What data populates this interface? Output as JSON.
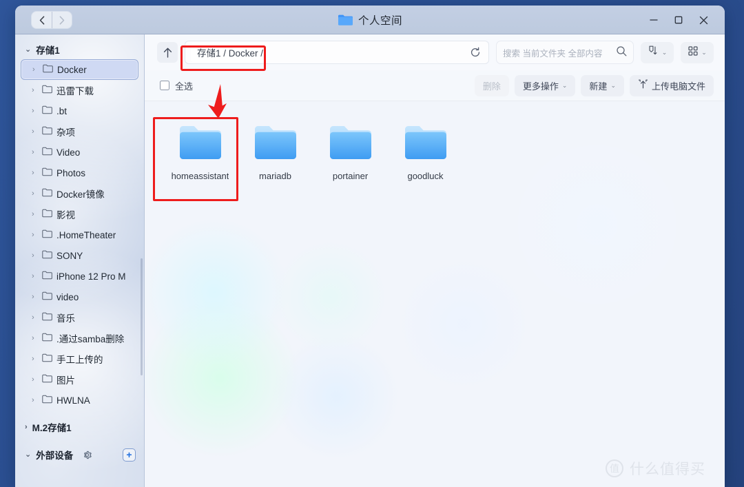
{
  "window": {
    "title": "个人空间",
    "title_folder_icon": "folder-icon",
    "nav": {
      "back": "‹",
      "forward": "›"
    },
    "controls": {
      "minimize": "minimize-icon",
      "maximize": "maximize-icon",
      "close": "close-icon"
    }
  },
  "sidebar": {
    "groups": [
      {
        "label": "存储1",
        "caret": "⌄",
        "expanded": true,
        "items": [
          {
            "label": "Docker",
            "selected": true
          },
          {
            "label": "迅雷下载",
            "selected": false
          },
          {
            "label": ".bt",
            "selected": false
          },
          {
            "label": "杂项",
            "selected": false
          },
          {
            "label": "Video",
            "selected": false
          },
          {
            "label": "Photos",
            "selected": false
          },
          {
            "label": "Docker镜像",
            "selected": false
          },
          {
            "label": "影视",
            "selected": false
          },
          {
            "label": ".HomeTheater",
            "selected": false
          },
          {
            "label": "SONY",
            "selected": false
          },
          {
            "label": "iPhone 12 Pro M",
            "selected": false
          },
          {
            "label": "video",
            "selected": false
          },
          {
            "label": "音乐",
            "selected": false
          },
          {
            "label": ".通过samba删除",
            "selected": false
          },
          {
            "label": "手工上传的",
            "selected": false
          },
          {
            "label": "图片",
            "selected": false
          },
          {
            "label": "HWLNA",
            "selected": false
          }
        ]
      },
      {
        "label": "M.2存储1",
        "caret": "›",
        "expanded": false,
        "items": []
      },
      {
        "label": "外部设备",
        "caret": "⌄",
        "expanded": true,
        "items": [],
        "gear_icon": "gear-icon",
        "plus_icon": "plus-icon",
        "plus_label": "+"
      }
    ]
  },
  "address_bar": {
    "up_label": "↑",
    "up_icon": "arrow-up-icon",
    "breadcrumb": "存储1 / Docker /",
    "refresh_icon": "refresh-icon"
  },
  "search": {
    "placeholder": "搜索 当前文件夹 全部内容",
    "icon": "search-icon"
  },
  "view_controls": {
    "sort": {
      "icon": "sort-filter-icon",
      "chevron": "⌄"
    },
    "layout": {
      "icon": "grid-view-icon",
      "chevron": "⌄"
    }
  },
  "toolbar": {
    "select_all_label": "全选",
    "delete_label": "删除",
    "delete_disabled": true,
    "more_actions_label": "更多操作",
    "more_actions_chevron": "⌄",
    "new_label": "新建",
    "new_chevron": "⌄",
    "upload_label": "上传电脑文件",
    "upload_icon": "upload-icon"
  },
  "files": [
    {
      "name": "homeassistant",
      "type": "folder",
      "highlighted": true
    },
    {
      "name": "mariadb",
      "type": "folder",
      "highlighted": false
    },
    {
      "name": "portainer",
      "type": "folder",
      "highlighted": false
    },
    {
      "name": "goodluck",
      "type": "folder",
      "highlighted": false
    }
  ],
  "annotations": {
    "color": "#ee1c1c",
    "path_box": "highlight-breadcrumb",
    "folder_box": "highlight-homeassistant-folder",
    "arrow": "down-arrow-pointing-to-folder"
  },
  "watermark": {
    "badge": "值",
    "text": "什么值得买"
  },
  "colors": {
    "desktop": "#2b4f91",
    "titlebar": "#c0cce1",
    "sidebar": "#ccd7ea",
    "selection": "#cfd9f3",
    "accent_blue": "#1f6fe0",
    "folder_blue": "#4aa7f5",
    "annotation_red": "#ee1c1c"
  }
}
